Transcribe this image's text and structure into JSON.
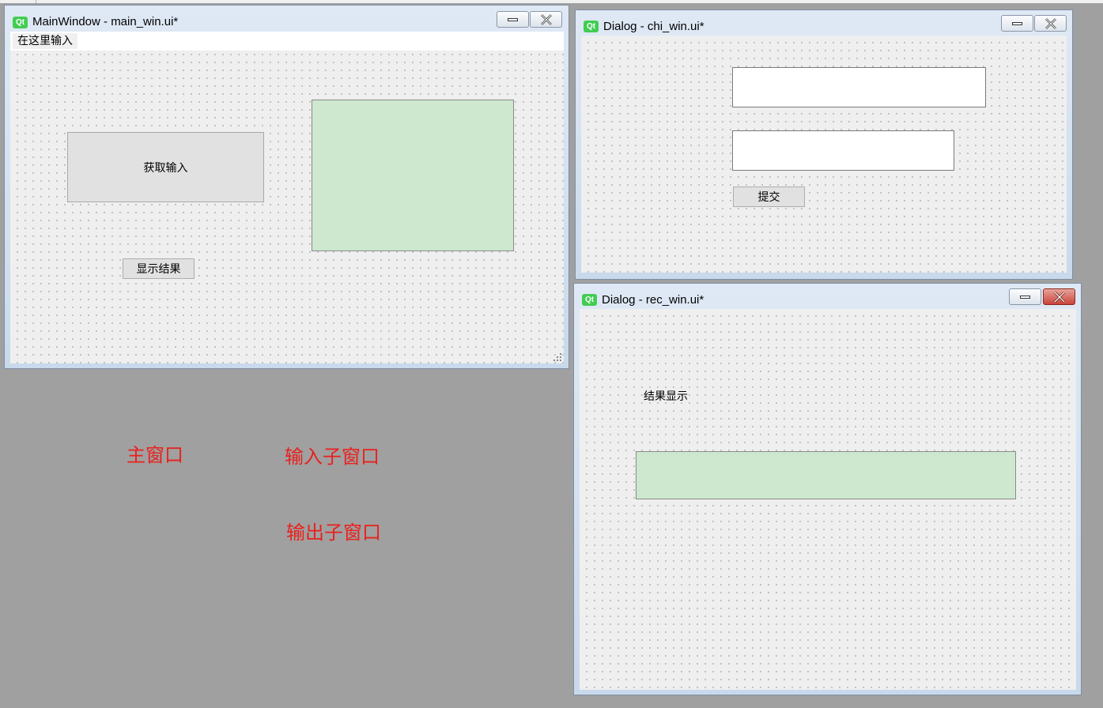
{
  "main_window": {
    "title": "MainWindow - main_win.ui*",
    "menu": "在这里输入",
    "get_input_button": "获取输入",
    "show_result_button": "显示结果"
  },
  "input_dialog": {
    "title": "Dialog - chi_win.ui*",
    "submit_button": "提交"
  },
  "output_dialog": {
    "title": "Dialog - rec_win.ui*",
    "result_label": "结果显示"
  },
  "annotations": {
    "main_window": "主窗口",
    "input_child": "输入子窗口",
    "output_child": "输出子窗口"
  },
  "colors": {
    "workspace": "#a0a0a0",
    "annotation": "#e8211d",
    "green_widget": "#cde8cf",
    "close_active": "#c9443a",
    "qt_logo": "#41cd52"
  },
  "icons": {
    "logo": "qt-logo-icon",
    "minimize": "minimize-icon",
    "close": "close-icon",
    "resize_grip": "resize-grip-icon"
  }
}
